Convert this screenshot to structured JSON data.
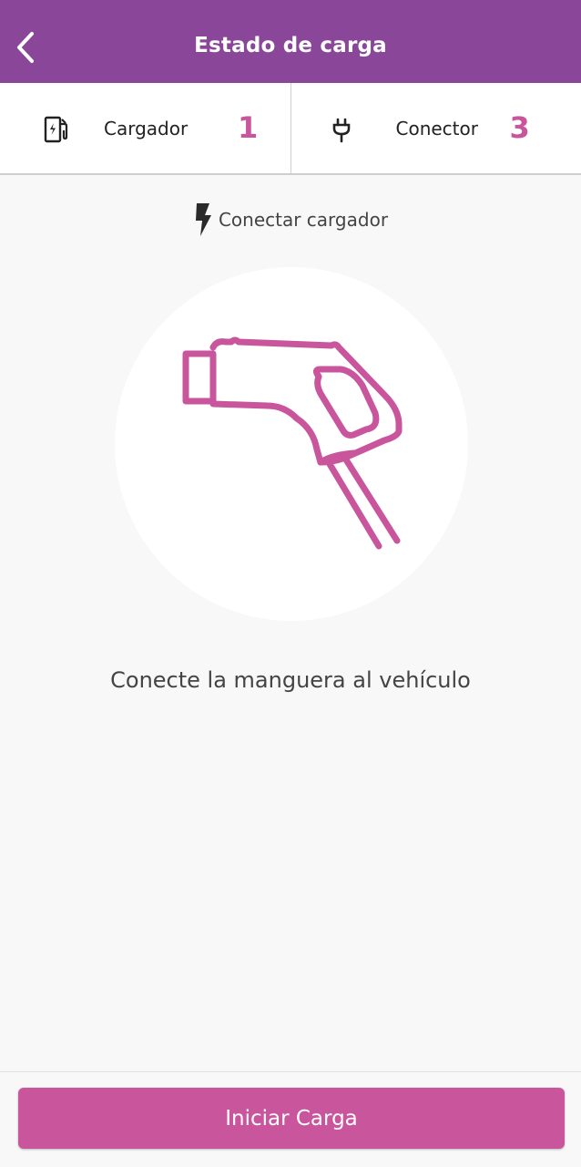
{
  "header": {
    "title": "Estado de carga"
  },
  "info": {
    "charger_label": "Cargador",
    "charger_number": "1",
    "connector_label": "Conector",
    "connector_number": "3"
  },
  "step": {
    "label": "Conectar cargador"
  },
  "instruction": "Conecte la manguera al vehículo",
  "footer": {
    "button_label": "Iniciar Carga"
  },
  "icons": {
    "back": "chevron-left-icon",
    "charger": "ev-station-icon",
    "connector": "plug-icon",
    "step": "lightning-bolt-icon",
    "illustration": "charging-gun-icon"
  },
  "colors": {
    "header": "#8a4799",
    "accent": "#c9559d",
    "background": "#f8f8f8"
  }
}
